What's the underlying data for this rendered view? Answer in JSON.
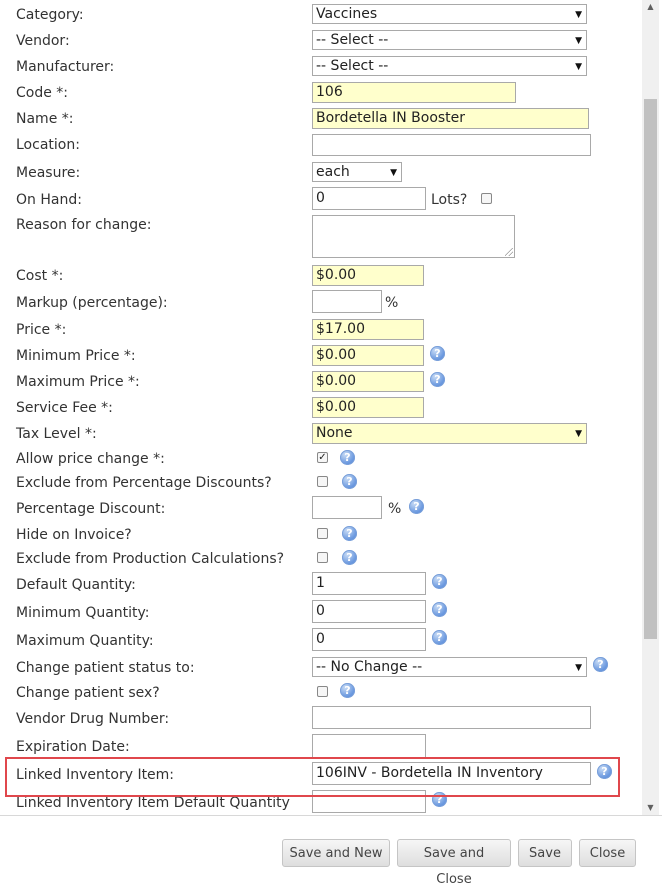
{
  "form": {
    "category": {
      "label": "Category:",
      "value": "Vaccines"
    },
    "vendor": {
      "label": "Vendor:",
      "value": "-- Select --"
    },
    "manufacturer": {
      "label": "Manufacturer:",
      "value": "-- Select --"
    },
    "code": {
      "label": "Code *:",
      "value": "106"
    },
    "name": {
      "label": "Name *:",
      "value": "Bordetella IN Booster"
    },
    "location": {
      "label": "Location:",
      "value": ""
    },
    "measure": {
      "label": "Measure:",
      "value": "each"
    },
    "on_hand": {
      "label": "On Hand:",
      "value": "0",
      "lots_label": "Lots?"
    },
    "reason": {
      "label": "Reason for change:"
    },
    "cost": {
      "label": "Cost *:",
      "value": "$0.00"
    },
    "markup": {
      "label": "Markup (percentage):",
      "value": "",
      "suffix": "%"
    },
    "price": {
      "label": "Price *:",
      "value": "$17.00"
    },
    "min_price": {
      "label": "Minimum Price *:",
      "value": "$0.00"
    },
    "max_price": {
      "label": "Maximum Price *:",
      "value": "$0.00"
    },
    "service_fee": {
      "label": "Service Fee *:",
      "value": "$0.00"
    },
    "tax_level": {
      "label": "Tax Level *:",
      "value": "None"
    },
    "allow_price_change": {
      "label": "Allow price change *:",
      "checked": true
    },
    "exclude_pct_discounts": {
      "label": "Exclude from Percentage Discounts?",
      "checked": false
    },
    "pct_discount": {
      "label": "Percentage Discount:",
      "value": "",
      "suffix": "%"
    },
    "hide_invoice": {
      "label": "Hide on Invoice?",
      "checked": false
    },
    "exclude_production": {
      "label": "Exclude from Production Calculations?",
      "checked": false
    },
    "default_qty": {
      "label": "Default Quantity:",
      "value": "1"
    },
    "min_qty": {
      "label": "Minimum Quantity:",
      "value": "0"
    },
    "max_qty": {
      "label": "Maximum Quantity:",
      "value": "0"
    },
    "patient_status": {
      "label": "Change patient status to:",
      "value": "-- No Change --"
    },
    "patient_sex": {
      "label": "Change patient sex?",
      "checked": false
    },
    "vendor_drug_number": {
      "label": "Vendor Drug Number:",
      "value": ""
    },
    "expiration_date": {
      "label": "Expiration Date:",
      "value": ""
    },
    "linked_item": {
      "label": "Linked Inventory Item:",
      "value": "106INV - Bordetella IN Inventory"
    },
    "linked_default_qty": {
      "label": "Linked Inventory Item Default Quantity",
      "value": ""
    }
  },
  "buttons": {
    "save_new": "Save and New",
    "save_close": "Save and Close",
    "save": "Save",
    "close": "Close"
  },
  "icons": {
    "help": "?",
    "check": "✓",
    "dropdown": "▼",
    "scroll_up": "▲",
    "scroll_down": "▼"
  },
  "colors": {
    "required_bg": "#ffffcc",
    "highlight": "#e0474c",
    "help_icon": "#6e9be0"
  }
}
